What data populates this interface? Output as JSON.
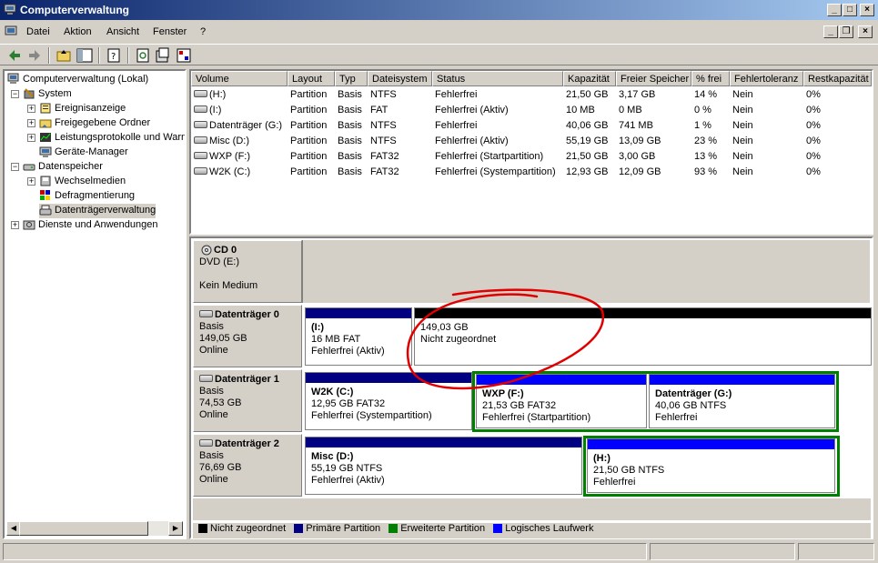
{
  "window": {
    "title": "Computerverwaltung",
    "min": "_",
    "max": "□",
    "close": "×"
  },
  "menu": [
    {
      "label": "Datei"
    },
    {
      "label": "Aktion"
    },
    {
      "label": "Ansicht"
    },
    {
      "label": "Fenster"
    },
    {
      "label": "?"
    }
  ],
  "tree": [
    {
      "label": "Computerverwaltung (Lokal)",
      "icon": "computer-icon"
    },
    {
      "label": "System",
      "icon": "system-tools-icon"
    },
    {
      "label": "Ereignisanzeige",
      "icon": "event-viewer-icon"
    },
    {
      "label": "Freigegebene Ordner",
      "icon": "shared-folder-icon"
    },
    {
      "label": "Leistungsprotokolle und Warnungen",
      "icon": "performance-icon"
    },
    {
      "label": "Geräte-Manager",
      "icon": "device-manager-icon"
    },
    {
      "label": "Datenspeicher",
      "icon": "storage-icon"
    },
    {
      "label": "Wechselmedien",
      "icon": "removable-media-icon"
    },
    {
      "label": "Defragmentierung",
      "icon": "defrag-icon"
    },
    {
      "label": "Datenträgerverwaltung",
      "icon": "disk-management-icon"
    },
    {
      "label": "Dienste und Anwendungen",
      "icon": "services-icon"
    }
  ],
  "columns": [
    "Volume",
    "Layout",
    "Typ",
    "Dateisystem",
    "Status",
    "Kapazität",
    "Freier Speicher",
    "% frei",
    "Fehlertoleranz",
    "Restkapazität"
  ],
  "volumes": [
    [
      "(H:)",
      "Partition",
      "Basis",
      "NTFS",
      "Fehlerfrei",
      "21,50 GB",
      "3,17 GB",
      "14 %",
      "Nein",
      "0%"
    ],
    [
      "(I:)",
      "Partition",
      "Basis",
      "FAT",
      "Fehlerfrei (Aktiv)",
      "10 MB",
      "0 MB",
      "0 %",
      "Nein",
      "0%"
    ],
    [
      "Datenträger (G:)",
      "Partition",
      "Basis",
      "NTFS",
      "Fehlerfrei",
      "40,06 GB",
      "741 MB",
      "1 %",
      "Nein",
      "0%"
    ],
    [
      "Misc (D:)",
      "Partition",
      "Basis",
      "NTFS",
      "Fehlerfrei (Aktiv)",
      "55,19 GB",
      "13,09 GB",
      "23 %",
      "Nein",
      "0%"
    ],
    [
      "WXP (F:)",
      "Partition",
      "Basis",
      "FAT32",
      "Fehlerfrei (Startpartition)",
      "21,50 GB",
      "3,00 GB",
      "13 %",
      "Nein",
      "0%"
    ],
    [
      "W2K (C:)",
      "Partition",
      "Basis",
      "FAT32",
      "Fehlerfrei (Systempartition)",
      "12,93 GB",
      "12,09 GB",
      "93 %",
      "Nein",
      "0%"
    ]
  ],
  "disks": [
    {
      "name": "CD 0",
      "l1": "DVD (E:)",
      "l2": "",
      "l3": "Kein Medium"
    },
    {
      "name": "Datenträger 0",
      "l1": "Basis",
      "l2": "149,05 GB",
      "l3": "Online",
      "parts": [
        {
          "name": "(I:)",
          "size": "16 MB FAT",
          "status": "Fehlerfrei (Aktiv)"
        },
        {
          "name": "",
          "size": "149,03 GB",
          "status": "Nicht zugeordnet"
        }
      ]
    },
    {
      "name": "Datenträger 1",
      "l1": "Basis",
      "l2": "74,53 GB",
      "l3": "Online",
      "parts": [
        {
          "name": "W2K  (C:)",
          "size": "12,95 GB FAT32",
          "status": "Fehlerfrei (Systempartition)"
        },
        {
          "name": "WXP  (F:)",
          "size": "21,53 GB FAT32",
          "status": "Fehlerfrei (Startpartition)"
        },
        {
          "name": "Datenträger  (G:)",
          "size": "40,06 GB NTFS",
          "status": "Fehlerfrei"
        }
      ]
    },
    {
      "name": "Datenträger 2",
      "l1": "Basis",
      "l2": "76,69 GB",
      "l3": "Online",
      "parts": [
        {
          "name": "Misc  (D:)",
          "size": "55,19 GB NTFS",
          "status": "Fehlerfrei (Aktiv)"
        },
        {
          "name": "(H:)",
          "size": "21,50 GB NTFS",
          "status": "Fehlerfrei"
        }
      ]
    }
  ],
  "legend": [
    {
      "label": "Nicht zugeordnet",
      "color": "#000000"
    },
    {
      "label": "Primäre Partition",
      "color": "#000080"
    },
    {
      "label": "Erweiterte Partition",
      "color": "#008000"
    },
    {
      "label": "Logisches Laufwerk",
      "color": "#0000ff"
    }
  ],
  "colors": {
    "primary": "#000080",
    "logical": "#0000ff",
    "extended": "#008000",
    "unallocated": "#000000",
    "annotation": "#e00000"
  }
}
